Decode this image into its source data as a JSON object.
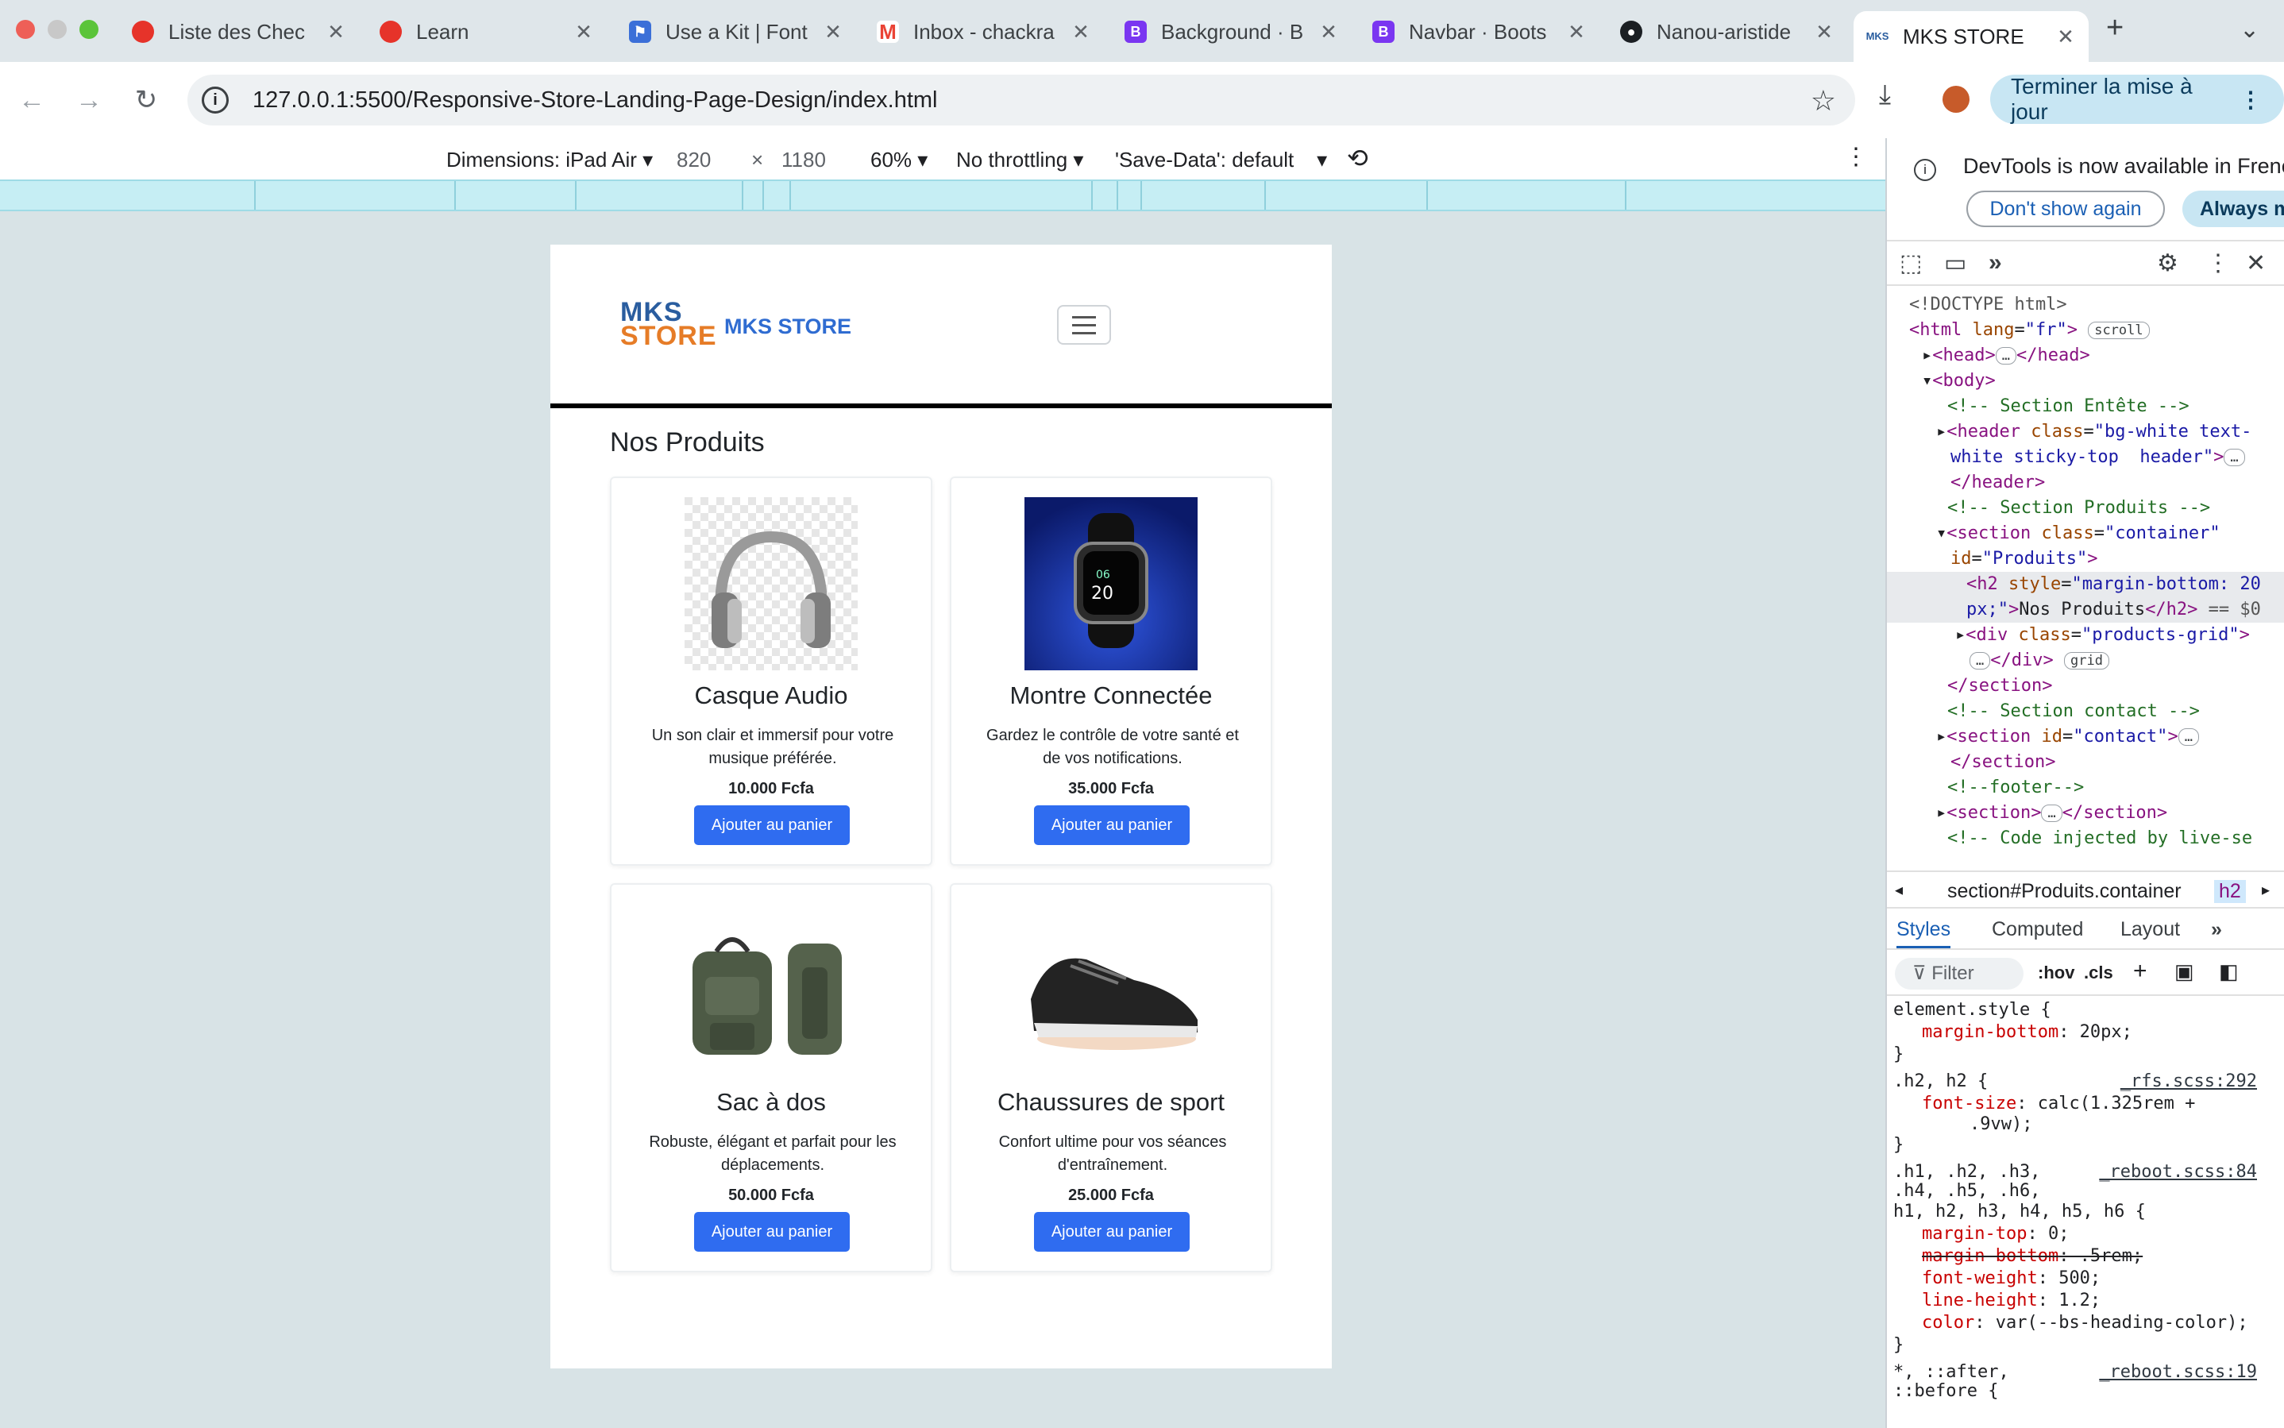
{
  "browser": {
    "tabs": [
      {
        "title": "Liste des Chec",
        "icon": "opera-icon",
        "color": "#e6332a"
      },
      {
        "title": "Learn",
        "icon": "opera-icon",
        "color": "#e6332a"
      },
      {
        "title": "Use a Kit | Font",
        "icon": "flag-icon",
        "color": "#3b6fd8"
      },
      {
        "title": "Inbox - chackra",
        "icon": "gmail-icon",
        "color": "#ea4335"
      },
      {
        "title": "Background · B",
        "icon": "bootstrap-icon",
        "color": "#7a36f1"
      },
      {
        "title": "Navbar · Boots",
        "icon": "bootstrap-icon",
        "color": "#7a36f1"
      },
      {
        "title": "Nanou-aristide",
        "icon": "github-icon",
        "color": "#1b1f23"
      },
      {
        "title": "MKS STORE",
        "icon": "mks-icon",
        "color": "#2a5d9f",
        "active": true
      }
    ],
    "url": "127.0.0.1:5500/Responsive-Store-Landing-Page-Design/index.html",
    "update_label": "Terminer la mise à jour"
  },
  "device_toolbar": {
    "dimensions": "Dimensions: iPad Air",
    "width": "820",
    "height": "1180",
    "zoom": "60%",
    "throttling": "No throttling",
    "save_data": "'Save-Data': default"
  },
  "site": {
    "logo_line1": "MKS",
    "logo_line2": "STORE",
    "brand": "MKS STORE",
    "section_title": "Nos Produits",
    "products": [
      {
        "name": "Casque Audio",
        "desc": "Un son clair et immersif pour votre musique préférée.",
        "price": "10.000 Fcfa",
        "button": "Ajouter au panier"
      },
      {
        "name": "Montre Connectée",
        "desc": "Gardez le contrôle de votre santé et de vos notifications.",
        "price": "35.000 Fcfa",
        "button": "Ajouter au panier"
      },
      {
        "name": "Sac à dos",
        "desc": "Robuste, élégant et parfait pour les déplacements.",
        "price": "50.000 Fcfa",
        "button": "Ajouter au panier"
      },
      {
        "name": "Chaussures de sport",
        "desc": "Confort ultime pour vos séances d'entraînement.",
        "price": "25.000 Fcfa",
        "button": "Ajouter au panier"
      }
    ]
  },
  "devtools": {
    "banner": "DevTools is now available in Frenc",
    "dont_show": "Don't show again",
    "always": "Always ma",
    "breadcrumb_section": "section#Produits.container",
    "breadcrumb_h2": "h2",
    "tabs": [
      "Styles",
      "Computed",
      "Layout"
    ],
    "filter": "Filter",
    "hov": ":hov",
    "cls": ".cls"
  }
}
